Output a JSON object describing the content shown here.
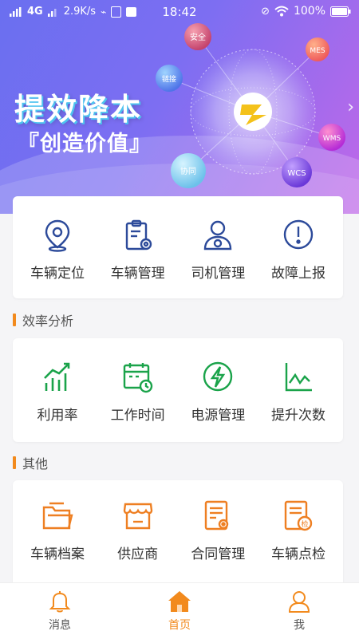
{
  "status_bar": {
    "network": "4G",
    "speed": "2.9K/s",
    "time": "18:42",
    "battery": "100%"
  },
  "banner": {
    "slogan_main": "提效降本",
    "slogan_sub": "『创造价值』",
    "bubbles": [
      "安全",
      "MES",
      "链接",
      "WMS",
      "协同",
      "WCS"
    ]
  },
  "quick_actions": [
    {
      "label": "车辆定位",
      "icon": "location-pin-icon"
    },
    {
      "label": "车辆管理",
      "icon": "clipboard-gear-icon"
    },
    {
      "label": "司机管理",
      "icon": "driver-icon"
    },
    {
      "label": "故障上报",
      "icon": "alert-circle-icon"
    }
  ],
  "efficiency": {
    "title": "效率分析",
    "items": [
      {
        "label": "利用率",
        "icon": "bar-chart-icon"
      },
      {
        "label": "工作时间",
        "icon": "calendar-clock-icon"
      },
      {
        "label": "电源管理",
        "icon": "power-bolt-icon"
      },
      {
        "label": "提升次数",
        "icon": "line-graph-icon"
      }
    ]
  },
  "other": {
    "title": "其他",
    "items": [
      {
        "label": "车辆档案",
        "icon": "folder-icon"
      },
      {
        "label": "供应商",
        "icon": "store-icon"
      },
      {
        "label": "合同管理",
        "icon": "contract-icon"
      },
      {
        "label": "车辆点检",
        "icon": "inspection-icon"
      }
    ]
  },
  "tabbar": [
    {
      "label": "消息",
      "icon": "bell-icon"
    },
    {
      "label": "首页",
      "icon": "home-icon"
    },
    {
      "label": "我",
      "icon": "user-icon"
    }
  ],
  "colors": {
    "blue": "#2c4a9a",
    "green": "#1aa34a",
    "orange": "#ee7f22",
    "accent": "#f28a1d"
  }
}
